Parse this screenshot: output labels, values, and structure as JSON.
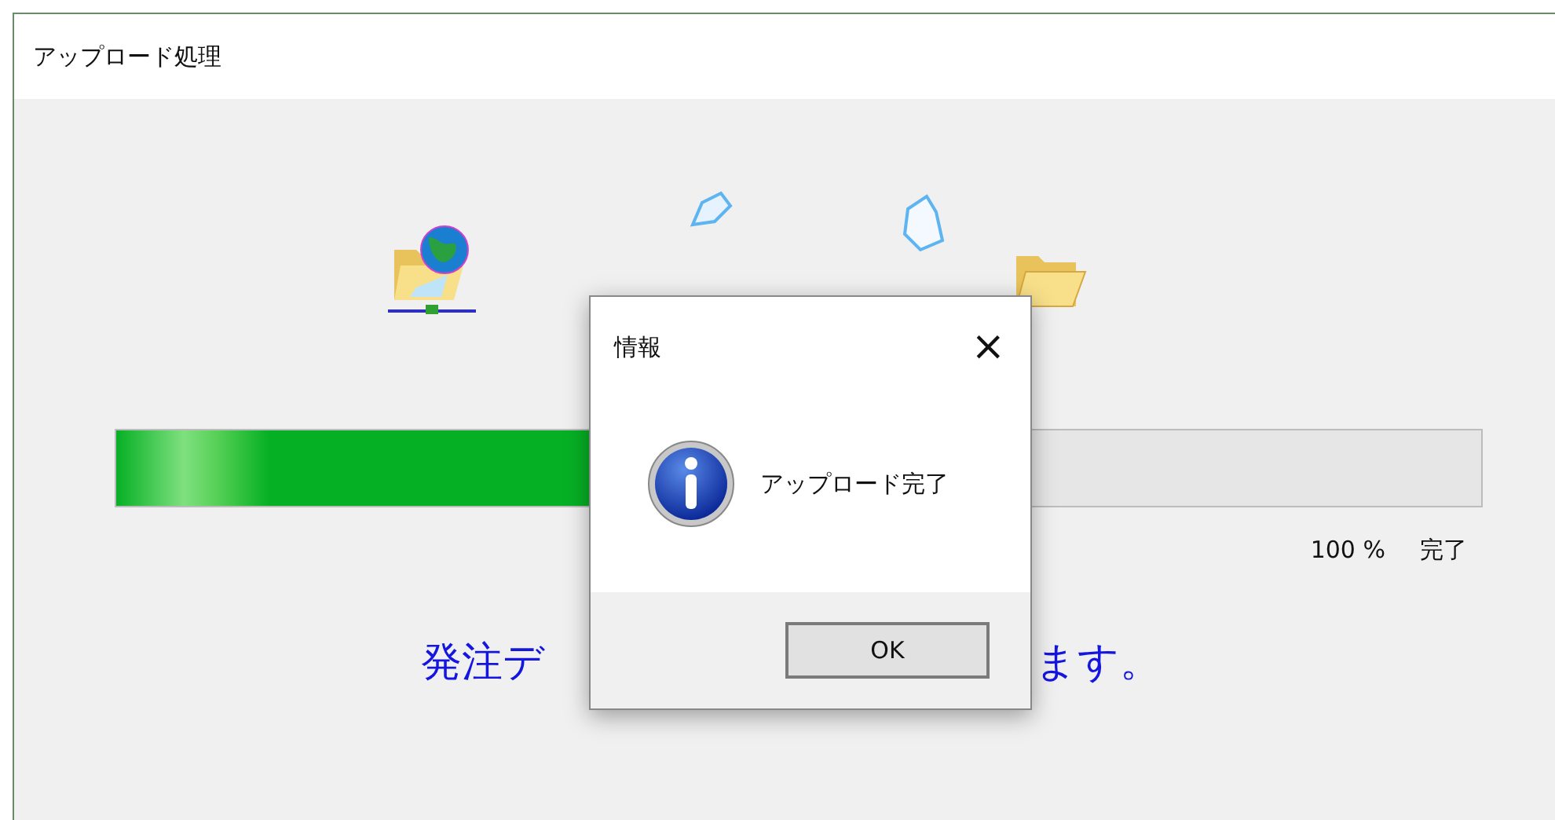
{
  "window": {
    "title": "アップロード処理"
  },
  "progress": {
    "level": 0.62,
    "percent": "100 %",
    "status": "完了"
  },
  "message_parts": [
    "発注デ",
    "ます。"
  ],
  "dialog": {
    "title": "情報",
    "close": "×",
    "message": "アップロード完了",
    "buttons": [
      "OK"
    ]
  }
}
